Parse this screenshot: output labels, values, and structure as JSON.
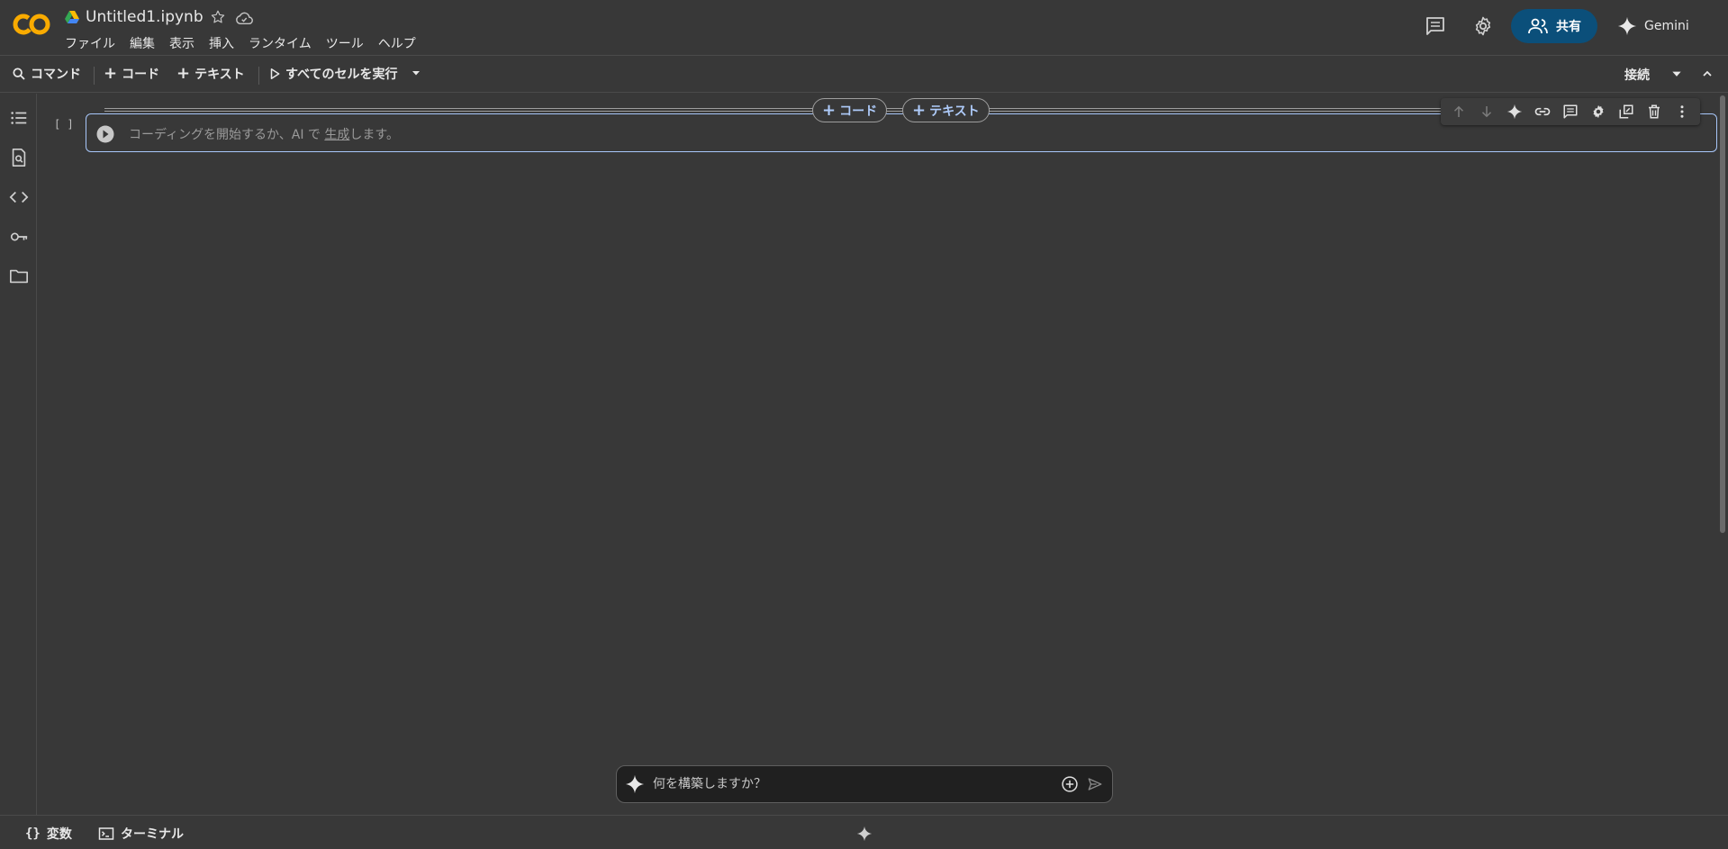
{
  "header": {
    "notebook_title": "Untitled1.ipynb",
    "menu": [
      "ファイル",
      "編集",
      "表示",
      "挿入",
      "ランタイム",
      "ツール",
      "ヘルプ"
    ],
    "share_label": "共有",
    "gemini_label": "Gemini"
  },
  "toolbar": {
    "command_label": "コマンド",
    "add_code_label": "コード",
    "add_text_label": "テキスト",
    "run_all_label": "すべてのセルを実行",
    "connect_label": "接続"
  },
  "cell": {
    "gutter": "[ ]",
    "placeholder_prefix": "コーディングを開始するか、AI で",
    "placeholder_link": "生成",
    "placeholder_suffix": "します。",
    "add_code_label": "コード",
    "add_text_label": "テキスト"
  },
  "prompt": {
    "placeholder": "何を構築しますか？"
  },
  "statusbar": {
    "variables_label": "変数",
    "terminal_label": "ターミナル"
  },
  "colors": {
    "background": "#383838",
    "accent_blue": "#a8c7fa",
    "share_bg": "#0b4f7a",
    "logo_orange": "#f9ab00"
  }
}
